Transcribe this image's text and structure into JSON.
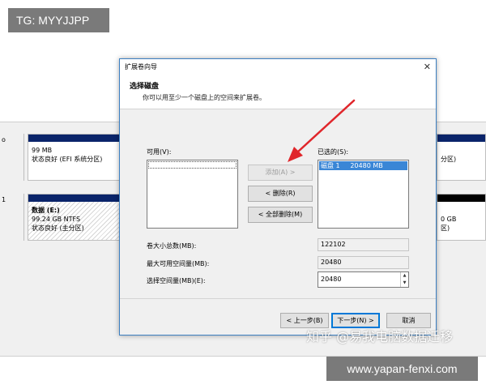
{
  "watermark_top_left": "TG: MYYJJPP",
  "watermark_bottom_right": "www.yapan-fenxi.com",
  "watermark_zhihu": "知乎 @易我电脑数据迁移",
  "background_disks": {
    "row1": {
      "head": "o",
      "left_partition": {
        "size": "99 MB",
        "status": "状态良好 (EFI 系统分区)"
      },
      "right_partition": {
        "status": "分区)"
      }
    },
    "row2": {
      "head": "1",
      "left_partition": {
        "name": "数据 (E:)",
        "size": "99.24 GB NTFS",
        "status": "状态良好 (主分区)"
      },
      "right_partition": {
        "size": "0 GB",
        "status": "区)"
      }
    }
  },
  "dialog": {
    "title": "扩展卷向导",
    "close_glyph": "✕",
    "header_title": "选择磁盘",
    "header_subtitle": "你可以用至少一个磁盘上的空间来扩展卷。",
    "available_label": "可用(V):",
    "selected_label": "已选的(S):",
    "selected_items": [
      "磁盘 1     20480 MB"
    ],
    "add_button": "添加(A) >",
    "remove_button": "< 删除(R)",
    "remove_all_button": "< 全部删除(M)",
    "total_size_label": "卷大小总数(MB):",
    "total_size_value": "122102",
    "max_space_label": "最大可用空间量(MB):",
    "max_space_value": "20480",
    "select_space_label": "选择空间量(MB)(E):",
    "select_space_value": "20480",
    "back_button": "< 上一步(B)",
    "next_button": "下一步(N) >",
    "cancel_button": "取消"
  },
  "colors": {
    "annotation_arrow": "#e0262b",
    "selection": "#3a86d6",
    "partition_header": "#0a246a"
  }
}
